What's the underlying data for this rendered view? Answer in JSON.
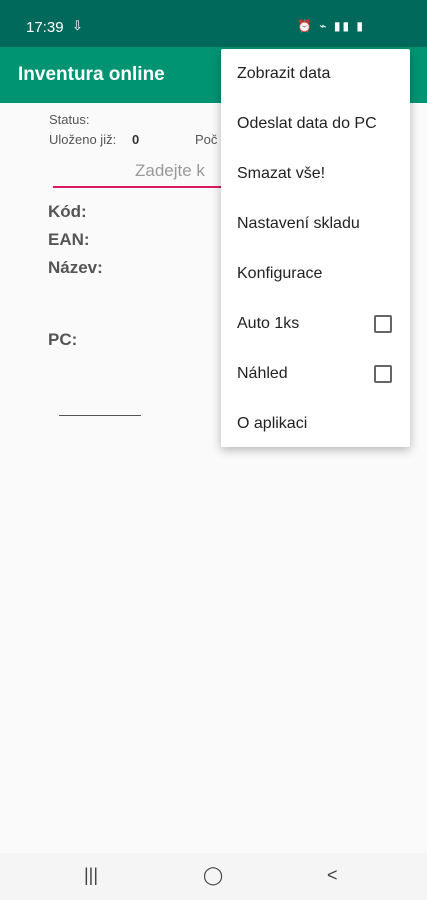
{
  "status_bar": {
    "time": "17:39",
    "left_icon": "download-icon",
    "right_icons": "⏰ ⌁ ▮▮ ▮"
  },
  "app_bar": {
    "title": "Inventura online"
  },
  "main": {
    "status_label": "Status:",
    "saved_label": "Uloženo již:",
    "saved_value": "0",
    "count_label": "Poč",
    "input_placeholder": "Zadejte k",
    "code_label": "Kód:",
    "ean_label": "EAN:",
    "name_label": "Název:",
    "pc_label": "PC:"
  },
  "menu": {
    "items": [
      {
        "label": "Zobrazit data"
      },
      {
        "label": "Odeslat data do PC"
      },
      {
        "label": "Smazat vše!"
      },
      {
        "label": "Nastavení skladu"
      },
      {
        "label": "Konfigurace"
      },
      {
        "label": "Auto 1ks",
        "checked": false
      },
      {
        "label": "Náhled",
        "checked": false
      },
      {
        "label": "O aplikaci"
      }
    ]
  },
  "nav_bar": {
    "recents": "|||",
    "home": "◯",
    "back": "<"
  }
}
